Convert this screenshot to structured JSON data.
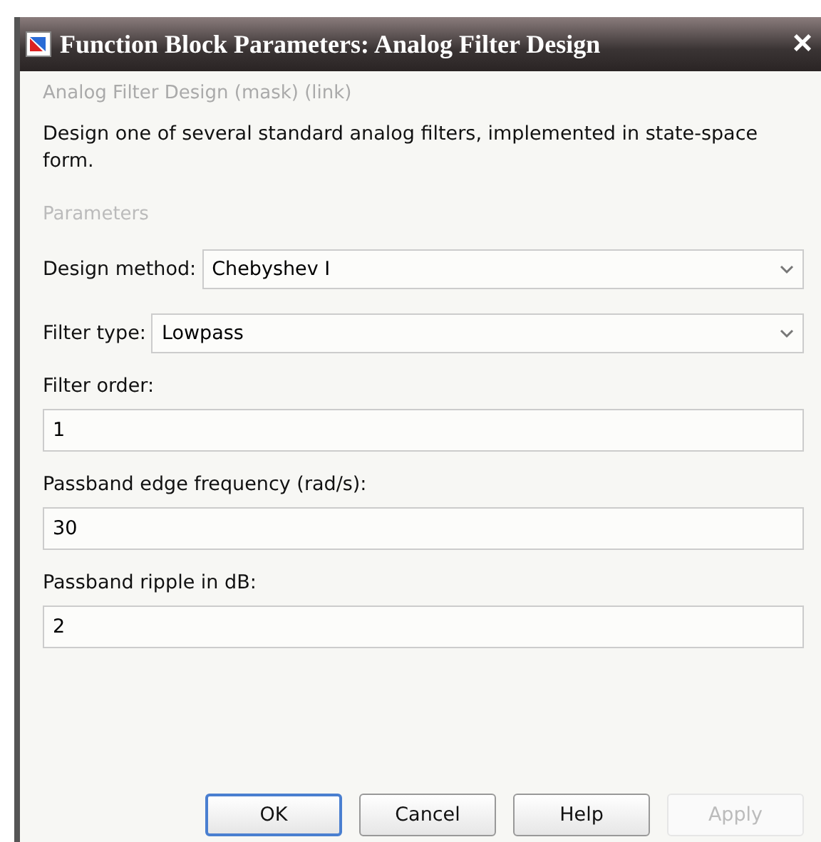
{
  "window": {
    "title": "Function Block Parameters: Analog Filter Design",
    "close": "×"
  },
  "subtitle": "Analog Filter Design (mask) (link)",
  "description": "Design one of several standard analog filters, implemented in state-space form.",
  "section": "Parameters",
  "parameters": [
    {
      "kind": "dropdown",
      "label": "Design method:",
      "value": "Chebyshev I"
    },
    {
      "kind": "dropdown",
      "label": "Filter type:",
      "value": "Lowpass"
    },
    {
      "kind": "text",
      "label": "Filter order:",
      "value": "1"
    },
    {
      "kind": "text",
      "label": "Passband edge frequency (rad/s):",
      "value": "30"
    },
    {
      "kind": "text",
      "label": "Passband ripple in dB:",
      "value": "2"
    }
  ],
  "buttons": [
    {
      "label": "OK",
      "disabled": false,
      "selected": true
    },
    {
      "label": "Cancel",
      "disabled": false,
      "selected": false
    },
    {
      "label": "Help",
      "disabled": false,
      "selected": false
    },
    {
      "label": "Apply",
      "disabled": true,
      "selected": false
    }
  ]
}
